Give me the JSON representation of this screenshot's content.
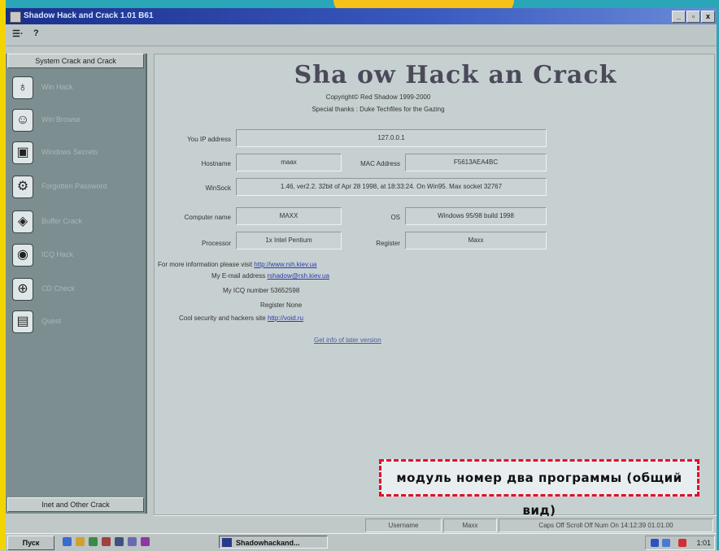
{
  "window": {
    "title": "Shadow Hack and Crack 1.01 B61",
    "controls": [
      "_",
      "▫",
      "x"
    ]
  },
  "menu": {
    "item1": "☰·",
    "help": "?"
  },
  "sidebar": {
    "header": "System Crack and Crack",
    "footer": "Inet and Other Crack",
    "items": [
      {
        "icon": "stopwatch-icon",
        "glyph": "♁",
        "label": "Win Hack"
      },
      {
        "icon": "people-icon",
        "glyph": "☺",
        "label": "Win Browse"
      },
      {
        "icon": "monitor-icon",
        "glyph": "▣",
        "label": "Windows Secrets"
      },
      {
        "icon": "network-icon",
        "glyph": "⚙",
        "label": "Forgotten Password"
      },
      {
        "icon": "shield-icon",
        "glyph": "◈",
        "label": "Buffer Crack"
      },
      {
        "icon": "globe-icon",
        "glyph": "◉",
        "label": "ICQ Hack"
      },
      {
        "icon": "dial-icon",
        "glyph": "⊕",
        "label": "CD Check"
      },
      {
        "icon": "document-icon",
        "glyph": "▤",
        "label": "Quest"
      }
    ]
  },
  "main": {
    "title": "Sha  ow Hack an   Crack",
    "copyright": "Copyright© Red Shadow 1999-2000",
    "thanks": "Special thanks : Duke Techfiles for the Gazing",
    "fields": {
      "ip_label": "You IP address",
      "ip_value": "127.0.0.1",
      "hostname_label": "Hostname",
      "hostname_value": "maax",
      "mac_label": "MAC Address",
      "mac_value": "F5613AEA4BC",
      "winsock_label": "WinSock",
      "winsock_value": "1.46, ver2.2. 32bit of Apr 28 1998, at 18:33:24. On Win95. Max socket 32767",
      "computer_label": "Computer name",
      "computer_value": "MAXX",
      "os_label": "OS",
      "os_value": "Windows 95/98 build 1998",
      "processor_label": "Processor",
      "processor_value": "1x Intel Pentium",
      "register_label": "Register",
      "register_value": "Maxx"
    },
    "info": {
      "more_info_label": "For more information please visit",
      "more_info_link": "http://www.rsh.kiev.ua",
      "email_label": "My E-mail address",
      "email_link": "rshadow@rsh.kiev.ua",
      "icq_label": "My ICQ number",
      "icq_value": "53652598",
      "register_label": "Register",
      "register_value": "None",
      "site_label": "Cool security and hackers site",
      "site_link": "http://void.ru"
    },
    "later_version": "Get info of later version"
  },
  "caption": "модуль номер два программы (общий вид)",
  "status": {
    "username_label": "Username",
    "username_value": "Maxx",
    "keys": "Caps Off  Scroll Off  Num On  14:12:39  01.01.00"
  },
  "taskbar": {
    "start": "Пуск",
    "task": "Shadowhackand...",
    "clock": "1:01"
  },
  "colors": {
    "titlebar": "#1a2f8a",
    "sidebar": "#7d8e90",
    "content_bg": "#c7d0d0",
    "caption_border": "#e0102a",
    "page_yellow": "#f2d400",
    "page_teal": "#2aa6b8"
  }
}
